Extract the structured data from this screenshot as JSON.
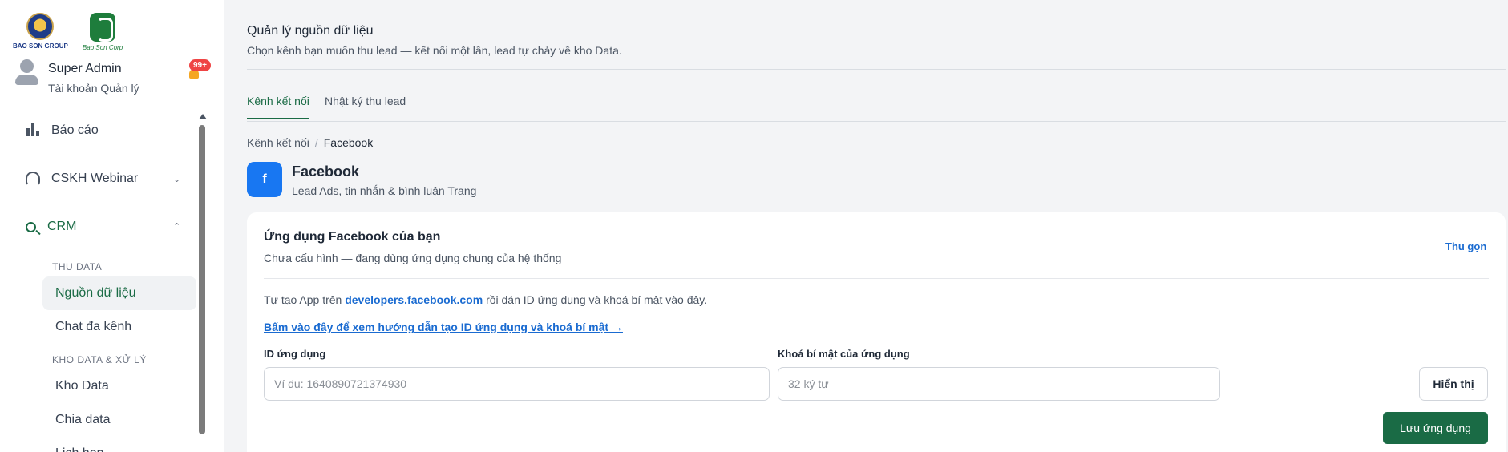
{
  "brand": {
    "logo1_text": "BAO SON GROUP",
    "logo2_text": "Bao Son Corp"
  },
  "user": {
    "name": "Super Admin",
    "role": "Tài khoản Quản lý",
    "notification_badge": "99+"
  },
  "sidebar": {
    "items": [
      {
        "label": "Báo cáo",
        "icon": "bar-chart-icon"
      },
      {
        "label": "CSKH Webinar",
        "icon": "headset-icon",
        "expanded": false
      },
      {
        "label": "CRM",
        "icon": "search-user-icon",
        "expanded": true
      }
    ],
    "sections": [
      {
        "label": "THU DATA",
        "items": [
          "Nguồn dữ liệu",
          "Chat đa kênh"
        ]
      },
      {
        "label": "KHO DATA & XỬ LÝ",
        "items": [
          "Kho Data",
          "Chia data",
          "Lịch hẹn"
        ]
      }
    ],
    "active_item": "Nguồn dữ liệu"
  },
  "page": {
    "title": "Quản lý nguồn dữ liệu",
    "subtitle": "Chọn kênh bạn muốn thu lead — kết nối một lần, lead tự chảy về kho Data."
  },
  "tabs": [
    {
      "label": "Kênh kết nối",
      "active": true
    },
    {
      "label": "Nhật ký thu lead",
      "active": false
    }
  ],
  "breadcrumb": {
    "parent": "Kênh kết nối",
    "separator": "/",
    "current": "Facebook"
  },
  "channel": {
    "icon_letter": "f",
    "name": "Facebook",
    "description": "Lead Ads, tin nhắn & bình luận Trang",
    "brand_color": "#1877f2"
  },
  "card": {
    "title": "Ứng dụng Facebook của bạn",
    "subtitle": "Chưa cấu hình — đang dùng ứng dụng chung của hệ thống",
    "collapse_label": "Thu gọn",
    "instruction_prefix": "Tự tạo App trên",
    "instruction_link": "developers.facebook.com",
    "instruction_suffix": "rồi dán ID ứng dụng và khoá bí mật vào đây.",
    "guide_link": "Bấm vào đây để xem hướng dẫn tạo ID ứng dụng và khoá bí mật →",
    "app_id_label": "ID ứng dụng",
    "app_id_placeholder": "Ví dụ: 1640890721374930",
    "app_id_value": "",
    "secret_label": "Khoá bí mật của ứng dụng",
    "secret_placeholder": "32 ký tự",
    "secret_value": "",
    "show_button": "Hiển thị",
    "save_button": "Lưu ứng dụng"
  },
  "colors": {
    "accent": "#1a6b45",
    "link": "#1a6bd1",
    "badge": "#ef4444"
  }
}
